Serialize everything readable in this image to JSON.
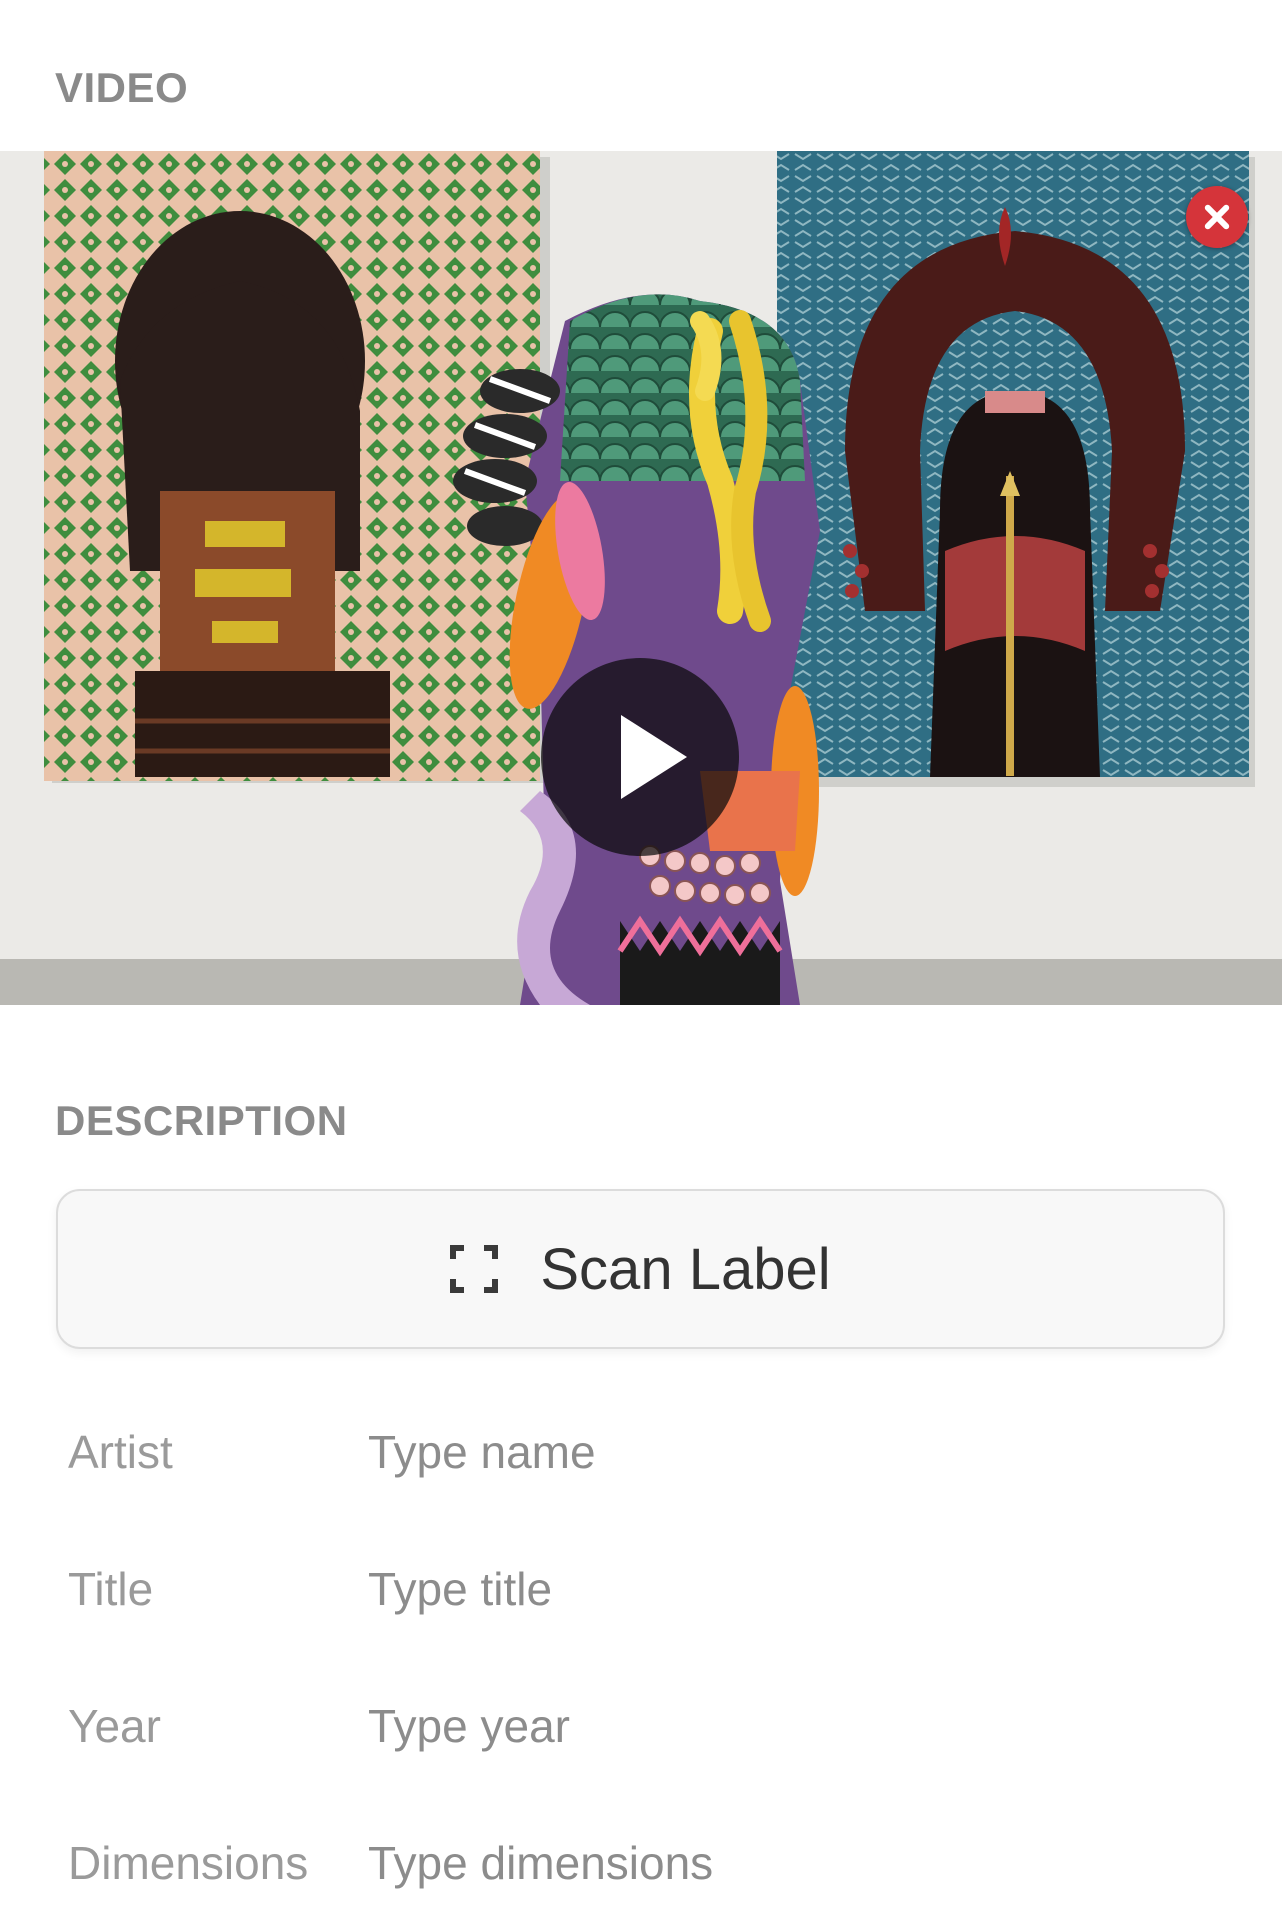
{
  "video_section": {
    "label": "VIDEO"
  },
  "description_section": {
    "label": "DESCRIPTION"
  },
  "scan_button": {
    "label": "Scan Label",
    "icon": "scan-frame-icon"
  },
  "video": {
    "play_icon": "play-icon",
    "remove_icon": "close-icon",
    "remove_color": "#d5343a"
  },
  "fields": {
    "artist": {
      "label": "Artist",
      "placeholder": "Type name",
      "value": ""
    },
    "title": {
      "label": "Title",
      "placeholder": "Type title",
      "value": ""
    },
    "year": {
      "label": "Year",
      "placeholder": "Type year",
      "value": ""
    },
    "dimensions": {
      "label": "Dimensions",
      "placeholder": "Type dimensions",
      "value": ""
    }
  }
}
